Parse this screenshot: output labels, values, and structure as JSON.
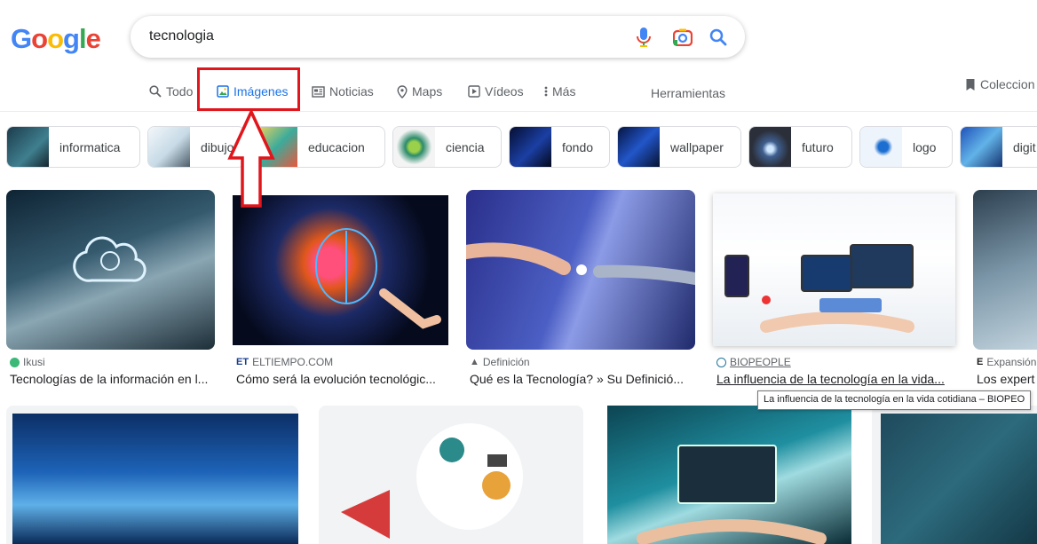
{
  "header": {
    "logo_text": "Google",
    "search_query": "tecnologia"
  },
  "tabs": [
    {
      "label": "Todo",
      "icon": "search-icon"
    },
    {
      "label": "Imágenes",
      "icon": "image-icon",
      "active": true
    },
    {
      "label": "Noticias",
      "icon": "newspaper-icon"
    },
    {
      "label": "Maps",
      "icon": "map-pin-icon"
    },
    {
      "label": "Vídeos",
      "icon": "play-icon"
    },
    {
      "label": "Más",
      "icon": "more-vert-icon"
    }
  ],
  "tools_label": "Herramientas",
  "collections_label": "Coleccion",
  "chips": [
    {
      "label": "informatica",
      "color": "#2a4d5e"
    },
    {
      "label": "dibujo",
      "color": "#d6e6ef"
    },
    {
      "label": "educacion",
      "color": "#e9c46a"
    },
    {
      "label": "ciencia",
      "color": "#1e6b52"
    },
    {
      "label": "fondo",
      "color": "#0b1f5c"
    },
    {
      "label": "wallpaper",
      "color": "#0f2a6b"
    },
    {
      "label": "futuro",
      "color": "#5a6b85"
    },
    {
      "label": "logo",
      "color": "#e8f2ff"
    },
    {
      "label": "digit",
      "color": "#2a5cbf"
    }
  ],
  "results": [
    {
      "source": "Ikusi",
      "title": "Tecnologías de la información en l...",
      "source_icon": "ikusi-logo-icon"
    },
    {
      "source": "ELTIEMPO.COM",
      "title": "Cómo será la evolución tecnológic...",
      "source_icon": "eltiempo-logo-icon"
    },
    {
      "source": "Definición",
      "title": "Qué es la Tecnología? » Su Definició...",
      "source_icon": "mortarboard-icon"
    },
    {
      "source": "BIOPEOPLE",
      "title": "La influencia de la tecnología en la vida...",
      "source_icon": "wordpress-logo-icon"
    },
    {
      "source": "Expansión",
      "title": "Los expert",
      "source_icon": "expansion-logo-icon"
    }
  ],
  "tooltip": "La influencia de la tecnología en la vida cotidiana – BIOPEO",
  "colors": {
    "google_blue": "#4285f4",
    "google_red": "#ea4335",
    "google_yellow": "#fbbc05",
    "google_green": "#34a853",
    "active_tab": "#1a73e8",
    "annotation_red": "#e0161c"
  }
}
